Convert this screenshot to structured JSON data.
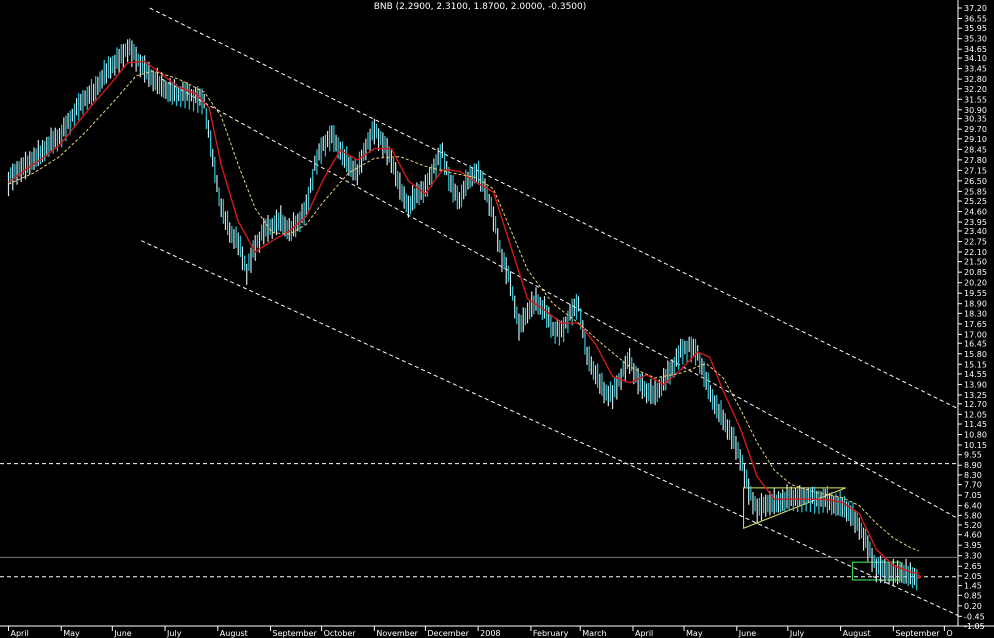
{
  "chart_data": {
    "type": "line",
    "title": "BNB (2.2900, 2.3100, 1.8700, 2.0000, -0.3500)",
    "xlabel": "",
    "ylabel": "",
    "ylim": [
      -1.05,
      37.2
    ],
    "y_scale": "linear",
    "y_axis_side": "right",
    "background": "#000000",
    "colors": {
      "price_bars": "#cfe6ee",
      "price_bars_alt": "#29c8d8",
      "moving_average_fast": "#d11a1a",
      "moving_average_slow": "#e8d37a",
      "channel_lines": "#ffffff",
      "triangle_pattern": "#e8e85a",
      "box_pattern": "#35d24a",
      "axis_text": "#ffffff",
      "axis_line": "#ffffff"
    },
    "y_ticks": [
      "37.20",
      "36.55",
      "35.95",
      "35.30",
      "34.65",
      "34.10",
      "33.45",
      "32.80",
      "32.20",
      "31.55",
      "30.90",
      "30.35",
      "29.70",
      "29.10",
      "28.45",
      "27.80",
      "27.15",
      "26.50",
      "25.85",
      "25.25",
      "24.60",
      "23.95",
      "23.40",
      "22.75",
      "22.10",
      "21.50",
      "20.85",
      "20.20",
      "19.55",
      "18.90",
      "18.30",
      "17.65",
      "17.00",
      "16.45",
      "15.80",
      "15.15",
      "14.55",
      "13.90",
      "13.25",
      "12.70",
      "12.05",
      "11.45",
      "10.80",
      "10.15",
      "9.55",
      "8.90",
      "8.30",
      "7.70",
      "7.05",
      "6.40",
      "5.80",
      "5.20",
      "4.60",
      "3.95",
      "3.30",
      "2.65",
      "2.05",
      "1.45",
      "0.85",
      "0.20",
      "-0.45",
      "-1.05"
    ],
    "x_ticks": [
      "April",
      "May",
      "June",
      "July",
      "August",
      "September",
      "October",
      "November",
      "December",
      "2008",
      "February",
      "March",
      "April",
      "May",
      "June",
      "July",
      "August",
      "September",
      "O"
    ],
    "x_tick_positions": [
      0,
      31,
      61,
      92,
      123,
      154,
      184,
      215,
      245,
      276,
      307,
      336,
      367,
      397,
      428,
      458,
      489,
      520,
      550
    ],
    "x_range": [
      -5,
      558
    ],
    "series": [
      {
        "style": "price",
        "values": [
          [
            0,
            26.5
          ],
          [
            5,
            27.2
          ],
          [
            10,
            27.5
          ],
          [
            15,
            28.0
          ],
          [
            20,
            28.4
          ],
          [
            25,
            29.0
          ],
          [
            30,
            29.3
          ],
          [
            35,
            30.1
          ],
          [
            40,
            31.0
          ],
          [
            45,
            31.7
          ],
          [
            50,
            32.1
          ],
          [
            55,
            33.0
          ],
          [
            60,
            33.7
          ],
          [
            65,
            34.1
          ],
          [
            70,
            34.8
          ],
          [
            75,
            34.2
          ],
          [
            80,
            33.5
          ],
          [
            85,
            32.9
          ],
          [
            90,
            32.5
          ],
          [
            95,
            32.1
          ],
          [
            100,
            32.0
          ],
          [
            105,
            31.9
          ],
          [
            110,
            31.7
          ],
          [
            115,
            31.5
          ],
          [
            120,
            28.0
          ],
          [
            125,
            25.0
          ],
          [
            130,
            23.5
          ],
          [
            135,
            22.8
          ],
          [
            140,
            21.0
          ],
          [
            145,
            22.5
          ],
          [
            150,
            23.5
          ],
          [
            155,
            23.8
          ],
          [
            160,
            24.2
          ],
          [
            165,
            23.5
          ],
          [
            170,
            24.0
          ],
          [
            175,
            24.9
          ],
          [
            180,
            27.5
          ],
          [
            185,
            28.8
          ],
          [
            190,
            29.4
          ],
          [
            195,
            28.5
          ],
          [
            200,
            27.6
          ],
          [
            205,
            27.1
          ],
          [
            210,
            28.7
          ],
          [
            215,
            29.7
          ],
          [
            220,
            28.9
          ],
          [
            225,
            27.9
          ],
          [
            230,
            26.2
          ],
          [
            235,
            25.0
          ],
          [
            240,
            25.8
          ],
          [
            245,
            26.1
          ],
          [
            250,
            27.4
          ],
          [
            255,
            28.3
          ],
          [
            260,
            26.3
          ],
          [
            265,
            25.4
          ],
          [
            270,
            26.7
          ],
          [
            275,
            27.2
          ],
          [
            280,
            26.2
          ],
          [
            285,
            24.3
          ],
          [
            290,
            21.8
          ],
          [
            295,
            20.3
          ],
          [
            300,
            17.5
          ],
          [
            305,
            18.5
          ],
          [
            310,
            19.2
          ],
          [
            315,
            18.6
          ],
          [
            320,
            17.4
          ],
          [
            325,
            17.2
          ],
          [
            330,
            18.3
          ],
          [
            335,
            19.0
          ],
          [
            340,
            15.8
          ],
          [
            345,
            14.7
          ],
          [
            350,
            13.6
          ],
          [
            355,
            13.3
          ],
          [
            360,
            14.5
          ],
          [
            365,
            15.5
          ],
          [
            370,
            14.2
          ],
          [
            375,
            13.6
          ],
          [
            380,
            13.4
          ],
          [
            385,
            14.2
          ],
          [
            390,
            15.0
          ],
          [
            395,
            16.0
          ],
          [
            400,
            16.3
          ],
          [
            405,
            15.9
          ],
          [
            410,
            14.2
          ],
          [
            415,
            12.8
          ],
          [
            420,
            11.9
          ],
          [
            425,
            10.8
          ],
          [
            430,
            9.5
          ],
          [
            435,
            7.4
          ],
          [
            440,
            6.2
          ],
          [
            445,
            6.6
          ],
          [
            450,
            6.7
          ],
          [
            455,
            6.8
          ],
          [
            460,
            7.0
          ],
          [
            465,
            6.9
          ],
          [
            470,
            7.0
          ],
          [
            475,
            6.8
          ],
          [
            480,
            6.9
          ],
          [
            485,
            6.6
          ],
          [
            490,
            6.5
          ],
          [
            495,
            6.0
          ],
          [
            500,
            5.2
          ],
          [
            505,
            3.9
          ],
          [
            510,
            2.6
          ],
          [
            515,
            2.5
          ],
          [
            520,
            2.3
          ],
          [
            525,
            2.4
          ],
          [
            530,
            2.2
          ],
          [
            535,
            2.0
          ]
        ]
      },
      {
        "style": "ma_fast",
        "values": [
          [
            0,
            26.4
          ],
          [
            10,
            27.2
          ],
          [
            20,
            27.9
          ],
          [
            30,
            28.7
          ],
          [
            40,
            30.0
          ],
          [
            50,
            31.3
          ],
          [
            60,
            32.5
          ],
          [
            70,
            33.8
          ],
          [
            80,
            33.9
          ],
          [
            90,
            33.1
          ],
          [
            100,
            32.3
          ],
          [
            110,
            31.9
          ],
          [
            118,
            31.0
          ],
          [
            125,
            27.5
          ],
          [
            135,
            24.0
          ],
          [
            145,
            22.1
          ],
          [
            155,
            22.8
          ],
          [
            165,
            23.4
          ],
          [
            175,
            24.3
          ],
          [
            185,
            26.6
          ],
          [
            195,
            28.4
          ],
          [
            205,
            27.8
          ],
          [
            215,
            28.5
          ],
          [
            225,
            28.5
          ],
          [
            235,
            26.5
          ],
          [
            245,
            25.7
          ],
          [
            255,
            27.2
          ],
          [
            265,
            27.1
          ],
          [
            275,
            26.4
          ],
          [
            285,
            25.8
          ],
          [
            295,
            22.5
          ],
          [
            305,
            19.2
          ],
          [
            315,
            18.5
          ],
          [
            325,
            17.7
          ],
          [
            335,
            17.7
          ],
          [
            345,
            16.4
          ],
          [
            355,
            14.4
          ],
          [
            365,
            14.0
          ],
          [
            375,
            14.5
          ],
          [
            385,
            13.9
          ],
          [
            395,
            14.8
          ],
          [
            405,
            15.9
          ],
          [
            412,
            15.6
          ],
          [
            420,
            13.5
          ],
          [
            430,
            11.2
          ],
          [
            440,
            8.2
          ],
          [
            450,
            6.8
          ],
          [
            460,
            6.8
          ],
          [
            470,
            6.8
          ],
          [
            480,
            6.8
          ],
          [
            490,
            6.6
          ],
          [
            500,
            5.9
          ],
          [
            510,
            3.7
          ],
          [
            520,
            2.7
          ],
          [
            530,
            2.3
          ],
          [
            535,
            2.2
          ]
        ]
      },
      {
        "style": "ma_slow",
        "values": [
          [
            0,
            26.3
          ],
          [
            15,
            27.0
          ],
          [
            30,
            28.0
          ],
          [
            45,
            29.5
          ],
          [
            60,
            31.2
          ],
          [
            75,
            33.0
          ],
          [
            85,
            33.3
          ],
          [
            100,
            32.8
          ],
          [
            115,
            32.0
          ],
          [
            125,
            30.5
          ],
          [
            135,
            27.5
          ],
          [
            145,
            24.8
          ],
          [
            155,
            23.3
          ],
          [
            165,
            23.2
          ],
          [
            175,
            23.8
          ],
          [
            185,
            25.2
          ],
          [
            200,
            27.0
          ],
          [
            215,
            27.9
          ],
          [
            230,
            28.0
          ],
          [
            245,
            27.4
          ],
          [
            260,
            27.0
          ],
          [
            275,
            26.7
          ],
          [
            285,
            26.0
          ],
          [
            295,
            23.5
          ],
          [
            305,
            21.0
          ],
          [
            320,
            18.9
          ],
          [
            335,
            17.7
          ],
          [
            350,
            16.3
          ],
          [
            365,
            15.0
          ],
          [
            380,
            14.3
          ],
          [
            395,
            14.6
          ],
          [
            410,
            15.2
          ],
          [
            420,
            14.3
          ],
          [
            430,
            12.4
          ],
          [
            440,
            10.3
          ],
          [
            450,
            8.6
          ],
          [
            460,
            7.7
          ],
          [
            475,
            7.2
          ],
          [
            490,
            6.9
          ],
          [
            500,
            6.4
          ],
          [
            510,
            5.3
          ],
          [
            520,
            4.4
          ],
          [
            530,
            3.8
          ],
          [
            535,
            3.6
          ]
        ]
      }
    ],
    "annotations": [
      {
        "type": "line",
        "style": "channel",
        "points": [
          [
            83,
            37.2
          ],
          [
            558,
            12.4
          ]
        ]
      },
      {
        "type": "line",
        "style": "channel",
        "points": [
          [
            90,
            32.8
          ],
          [
            558,
            5.6
          ]
        ]
      },
      {
        "type": "line",
        "style": "channel",
        "points": [
          [
            78,
            22.8
          ],
          [
            558,
            -0.4
          ]
        ]
      },
      {
        "type": "line",
        "style": "hline",
        "points": [
          [
            -5,
            9.0
          ],
          [
            558,
            9.0
          ]
        ]
      },
      {
        "type": "line",
        "style": "hline",
        "points": [
          [
            -5,
            2.0
          ],
          [
            558,
            2.0
          ]
        ]
      },
      {
        "type": "line",
        "style": "hline_solid",
        "points": [
          [
            -5,
            3.2
          ],
          [
            558,
            3.2
          ]
        ]
      },
      {
        "type": "polygon",
        "style": "triangle",
        "points": [
          [
            432,
            7.5
          ],
          [
            432,
            5.0
          ],
          [
            492,
            7.5
          ]
        ]
      },
      {
        "type": "rect",
        "style": "box",
        "points": [
          [
            496,
            2.9
          ],
          [
            524,
            1.8
          ]
        ]
      }
    ]
  }
}
